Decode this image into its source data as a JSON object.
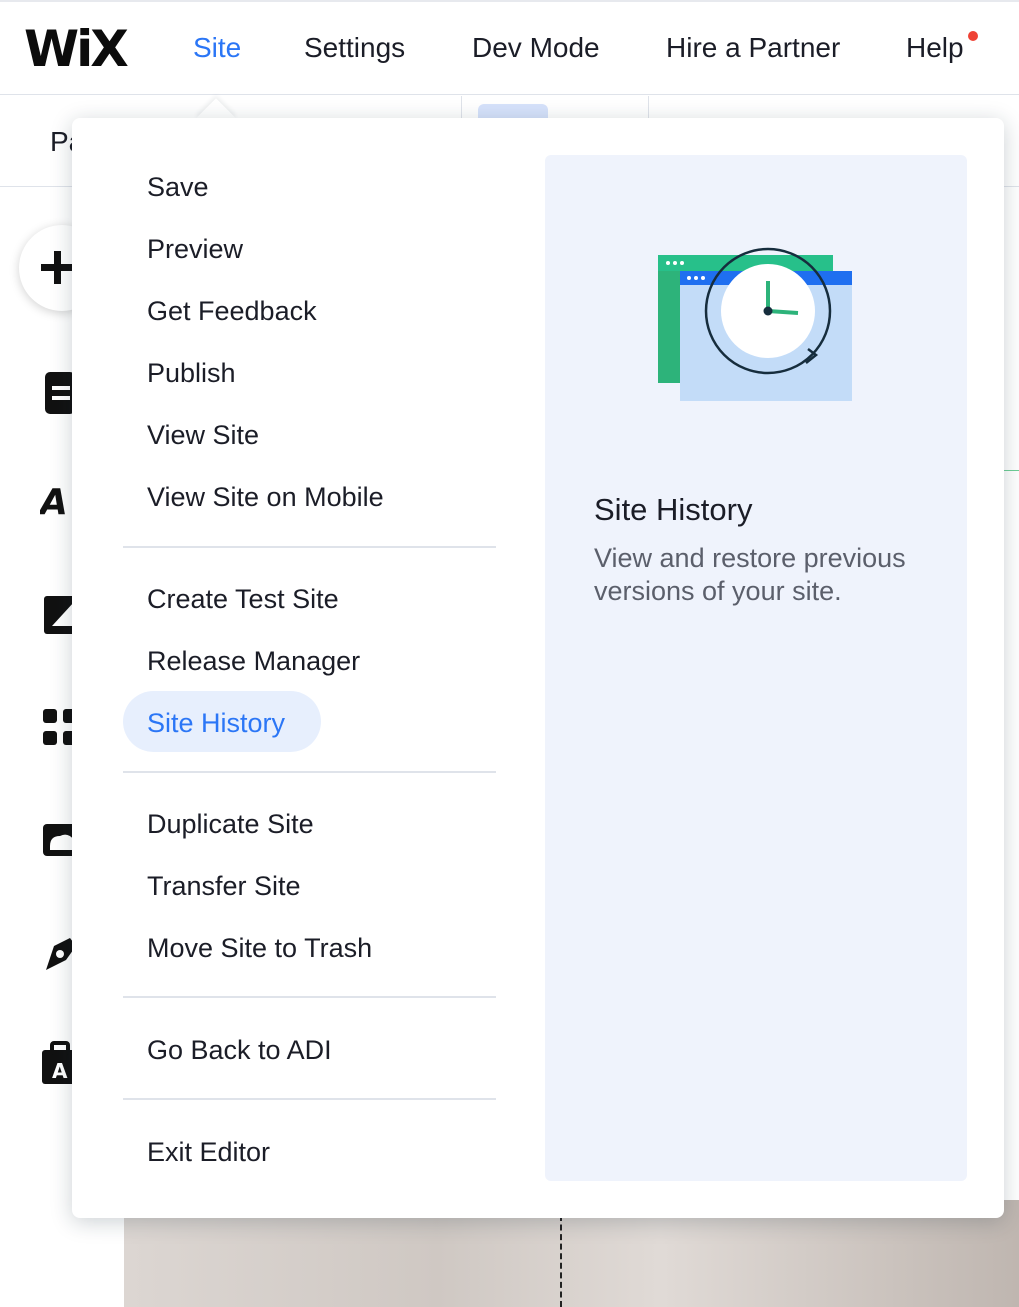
{
  "app": {
    "logo_text": "WiX",
    "brand_accent": "#2b76f6"
  },
  "topnav": {
    "items": [
      {
        "label": "Site",
        "active": true
      },
      {
        "label": "Settings",
        "active": false
      },
      {
        "label": "Dev Mode",
        "active": false
      },
      {
        "label": "Hire a Partner",
        "active": false
      },
      {
        "label": "Help",
        "active": false,
        "notification_dot": true
      }
    ]
  },
  "subbar": {
    "label_fragment": "Pa"
  },
  "rail": {
    "icons": [
      "add-icon",
      "pages-icon",
      "text-font-icon",
      "background-icon",
      "apps-grid-icon",
      "media-cloud-icon",
      "pen-tool-icon",
      "business-bag-icon"
    ]
  },
  "site_menu": {
    "groups": [
      [
        "Save",
        "Preview",
        "Get Feedback",
        "Publish",
        "View Site",
        "View Site on Mobile"
      ],
      [
        "Create Test Site",
        "Release Manager",
        "Site History"
      ],
      [
        "Duplicate Site",
        "Transfer Site",
        "Move Site to Trash"
      ],
      [
        "Go Back to ADI"
      ],
      [
        "Exit Editor"
      ]
    ],
    "selected_item": "Site History"
  },
  "info_panel": {
    "title": "Site History",
    "description": "View and restore previous versions of your site.",
    "illustration": "site-history-clock-icon"
  }
}
